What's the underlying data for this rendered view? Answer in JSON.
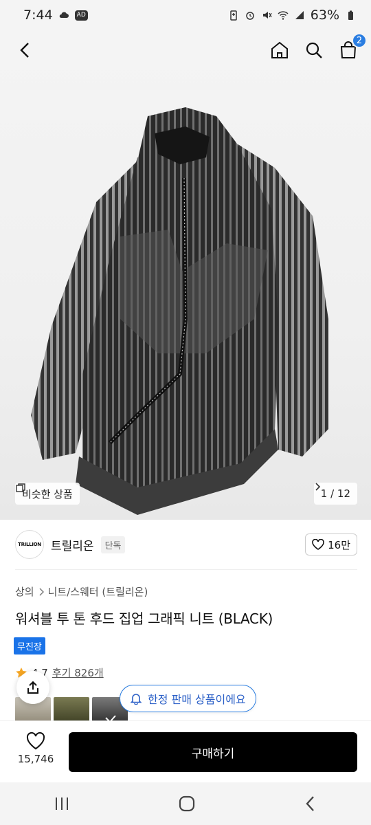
{
  "status_bar": {
    "time": "7:44",
    "ad_badge": "AD",
    "battery": "63%"
  },
  "header": {
    "cart_count": "2"
  },
  "hero": {
    "similar_label": "비슷한 상품",
    "page_indicator": "1 / 12"
  },
  "brand": {
    "logo_text": "TRILLION",
    "name": "트릴리온",
    "exclusive_tag": "단독",
    "like_count": "16만"
  },
  "breadcrumb": {
    "category": "상의",
    "subcategory": "니트/스웨터 (트릴리온)"
  },
  "product": {
    "title": "워셔블 투 톤 후드 집업 그래픽 니트 (BLACK)",
    "shipping_badge": "무진장",
    "rating": "4.7",
    "reviews": "후기 826개"
  },
  "limited_notice": "한정 판매 상품이에요",
  "buy_bar": {
    "favorite_count": "15,746",
    "buy_label": "구매하기"
  },
  "colors": {
    "accent": "#2a7de1",
    "buy_button": "#000000",
    "badge": "#1a73e8"
  }
}
